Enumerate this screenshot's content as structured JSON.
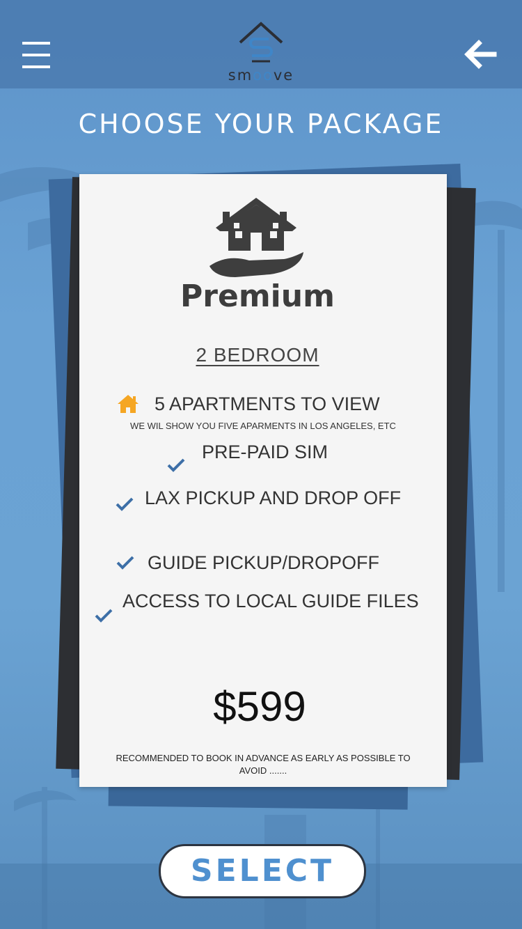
{
  "header": {
    "logo_text_part1": "sm",
    "logo_text_part2": "oo",
    "logo_text_part3": "ve",
    "menu_icon": "hamburger-menu-icon",
    "back_icon": "arrow-left-icon"
  },
  "title": "CHOOSE YOUR PACKAGE",
  "package": {
    "name": "Premium",
    "bedroom": "2 BEDROOM",
    "features": [
      {
        "label": "5 APARTMENTS TO VIEW",
        "icon": "home-icon",
        "sub": "WE WIL SHOW YOU FIVE APARMENTS IN LOS ANGELES, ETC"
      },
      {
        "label": "PRE-PAID SIM",
        "icon": "check-icon"
      },
      {
        "label": "LAX PICKUP AND DROP OFF",
        "icon": "check-icon"
      },
      {
        "label": "GUIDE PICKUP/DROPOFF",
        "icon": "check-icon"
      },
      {
        "label": "ACCESS TO LOCAL GUIDE FILES",
        "icon": "check-icon"
      }
    ],
    "price": "$599",
    "note": "RECOMMENDED TO BOOK IN ADVANCE AS EARLY AS POSSIBLE TO AVOID ......."
  },
  "select_label": "SELECT",
  "colors": {
    "accent": "#4f90cf",
    "header_bg": "#4676aa",
    "home_icon": "#f5a623",
    "check": "#3d6fa7"
  }
}
